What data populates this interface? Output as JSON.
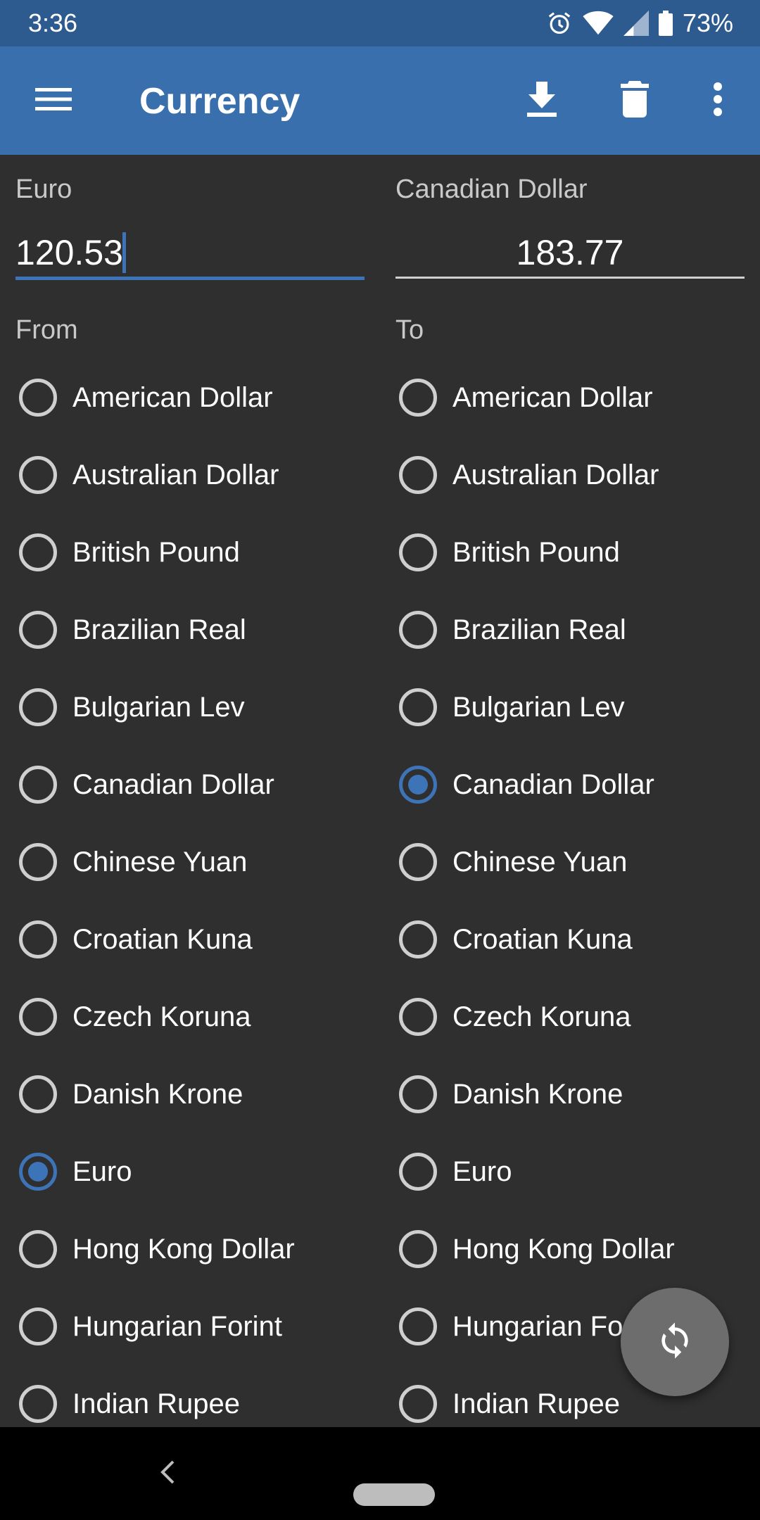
{
  "status_bar": {
    "time": "3:36",
    "battery": "73%",
    "icons": [
      "alarm-icon",
      "wifi-icon",
      "signal-icon",
      "battery-icon"
    ]
  },
  "app_bar": {
    "title": "Currency",
    "icons": [
      "menu-icon",
      "download-icon",
      "delete-icon",
      "more-vert-icon"
    ],
    "color": "#3a6fad"
  },
  "from_field": {
    "label": "Euro",
    "value": "120.53"
  },
  "to_field": {
    "label": "Canadian Dollar",
    "value": "183.77"
  },
  "from_section": {
    "label": "From",
    "selected": "Euro",
    "items": [
      "American Dollar",
      "Australian Dollar",
      "British Pound",
      "Brazilian Real",
      "Bulgarian Lev",
      "Canadian Dollar",
      "Chinese Yuan",
      "Croatian Kuna",
      "Czech Koruna",
      "Danish Krone",
      "Euro",
      "Hong Kong Dollar",
      "Hungarian Forint",
      "Indian Rupee"
    ]
  },
  "to_section": {
    "label": "To",
    "selected": "Canadian Dollar",
    "items": [
      "American Dollar",
      "Australian Dollar",
      "British Pound",
      "Brazilian Real",
      "Bulgarian Lev",
      "Canadian Dollar",
      "Chinese Yuan",
      "Croatian Kuna",
      "Czech Koruna",
      "Danish Krone",
      "Euro",
      "Hong Kong Dollar",
      "Hungarian Forint",
      "Indian Rupee"
    ]
  },
  "fab": {
    "icon": "refresh-icon"
  },
  "colors": {
    "accent": "#3d74b8",
    "background": "#2f2f30",
    "status_bar": "#2d5a8f"
  }
}
